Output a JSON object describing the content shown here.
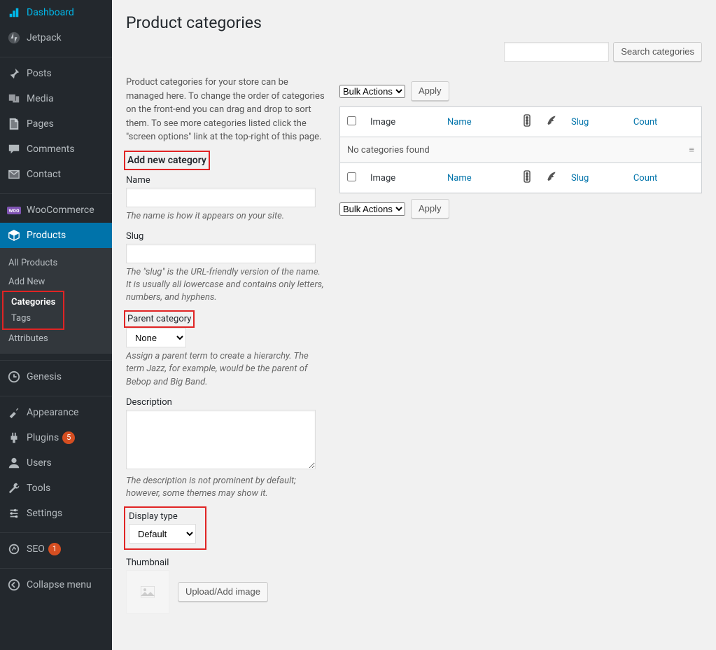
{
  "sidebar": {
    "items": [
      {
        "icon": "dashboard",
        "label": "Dashboard"
      },
      {
        "icon": "jetpack",
        "label": "Jetpack"
      },
      {
        "icon": "pin",
        "label": "Posts"
      },
      {
        "icon": "media",
        "label": "Media"
      },
      {
        "icon": "page",
        "label": "Pages"
      },
      {
        "icon": "comment",
        "label": "Comments"
      },
      {
        "icon": "contact",
        "label": "Contact"
      },
      {
        "icon": "woo",
        "label": "WooCommerce"
      },
      {
        "icon": "products",
        "label": "Products"
      },
      {
        "icon": "genesis",
        "label": "Genesis"
      },
      {
        "icon": "appearance",
        "label": "Appearance"
      },
      {
        "icon": "plugins",
        "label": "Plugins",
        "badge": "5"
      },
      {
        "icon": "users",
        "label": "Users"
      },
      {
        "icon": "tools",
        "label": "Tools"
      },
      {
        "icon": "settings",
        "label": "Settings"
      },
      {
        "icon": "seo",
        "label": "SEO",
        "badge": "1"
      },
      {
        "icon": "collapse",
        "label": "Collapse menu"
      }
    ],
    "submenu": {
      "items": [
        {
          "label": "All Products"
        },
        {
          "label": "Add New"
        },
        {
          "label": "Categories"
        },
        {
          "label": "Tags"
        },
        {
          "label": "Attributes"
        }
      ]
    }
  },
  "page": {
    "title": "Product categories",
    "search_button": "Search categories",
    "intro": "Product categories for your store can be managed here. To change the order of categories on the front-end you can drag and drop to sort them. To see more categories listed click the \"screen options\" link at the top-right of this page."
  },
  "form": {
    "heading": "Add new category",
    "name": {
      "label": "Name",
      "hint": "The name is how it appears on your site."
    },
    "slug": {
      "label": "Slug",
      "hint": "The \"slug\" is the URL-friendly version of the name. It is usually all lowercase and contains only letters, numbers, and hyphens."
    },
    "parent": {
      "label": "Parent category",
      "value": "None",
      "hint": "Assign a parent term to create a hierarchy. The term Jazz, for example, would be the parent of Bebop and Big Band."
    },
    "description": {
      "label": "Description",
      "hint": "The description is not prominent by default; however, some themes may show it."
    },
    "display_type": {
      "label": "Display type",
      "value": "Default"
    },
    "thumbnail": {
      "label": "Thumbnail",
      "button": "Upload/Add image"
    }
  },
  "table": {
    "bulk_actions": "Bulk Actions",
    "apply": "Apply",
    "columns": {
      "image": "Image",
      "name": "Name",
      "slug": "Slug",
      "count": "Count"
    },
    "no_items": "No categories found"
  }
}
